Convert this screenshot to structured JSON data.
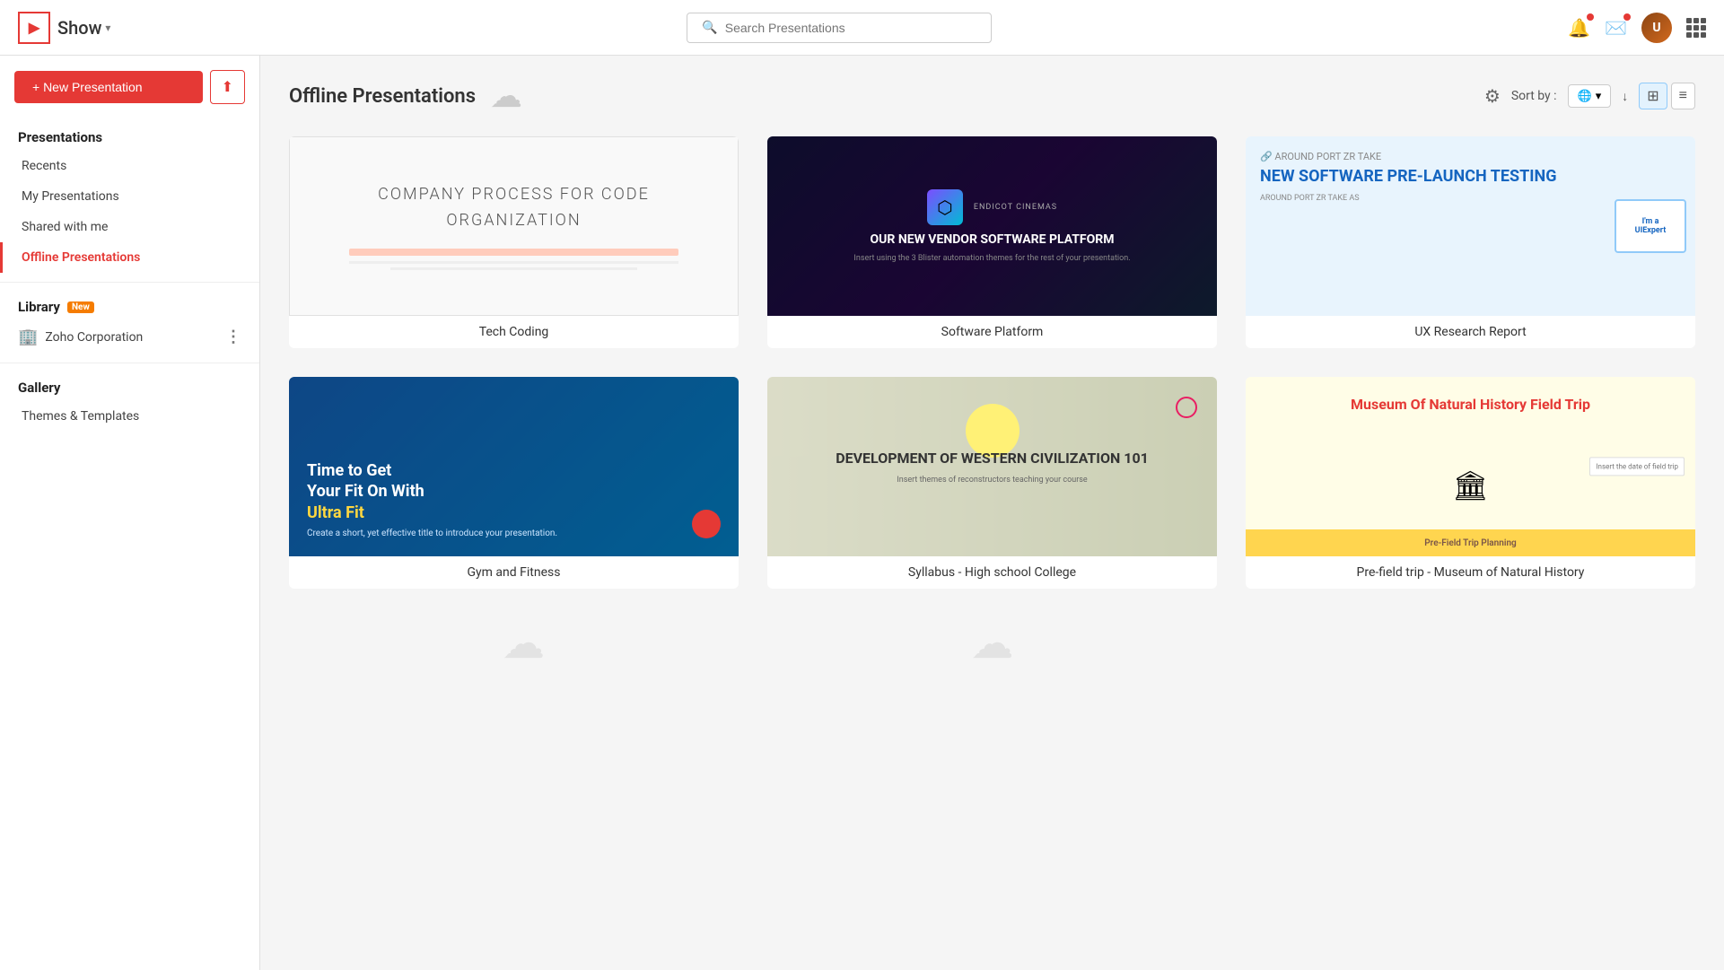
{
  "header": {
    "app_name": "Show",
    "app_arrow": "▾",
    "search_placeholder": "Search Presentations",
    "logo_symbol": "▶"
  },
  "sidebar": {
    "new_presentation_label": "+ New Presentation",
    "upload_label": "⬆",
    "presentations_section": "Presentations",
    "nav_items": [
      {
        "id": "recents",
        "label": "Recents"
      },
      {
        "id": "my-presentations",
        "label": "My Presentations"
      },
      {
        "id": "shared-with-me",
        "label": "Shared with me"
      },
      {
        "id": "offline-presentations",
        "label": "Offline Presentations"
      }
    ],
    "library_section": "Library",
    "library_badge": "New",
    "library_items": [
      {
        "id": "zoho-corp",
        "label": "Zoho Corporation",
        "icon": "🏢"
      }
    ],
    "gallery_section": "Gallery",
    "gallery_items": [
      {
        "id": "themes-templates",
        "label": "Themes & Templates"
      }
    ]
  },
  "main": {
    "title": "Offline Presentations",
    "sort_label": "Sort by :",
    "sort_option": "🌐",
    "presentations": [
      {
        "id": "tech-coding",
        "name": "Tech Coding",
        "thumb_type": "tech",
        "thumb_title": "COMPANY PROCESS FOR CODE ORGANIZATION"
      },
      {
        "id": "software-platform",
        "name": "Software Platform",
        "thumb_type": "software",
        "thumb_company": "ENDICOT CINEMAS",
        "thumb_subtitle": "OUR NEW VENDOR SOFTWARE PLATFORM"
      },
      {
        "id": "ux-research",
        "name": "UX Research Report",
        "thumb_type": "ux",
        "thumb_title": "NEW SOFTWARE PRE-LAUNCH TESTING",
        "thumb_device_label": "I'm a\nUIExpert"
      },
      {
        "id": "gym-fitness",
        "name": "Gym and Fitness",
        "thumb_type": "gym",
        "thumb_line1": "Time to Get",
        "thumb_line2": "Your Fit On With",
        "thumb_highlight": "Ultra Fit",
        "thumb_subtitle": "Create a short, yet effective title to introduce your presentation."
      },
      {
        "id": "syllabus",
        "name": "Syllabus - High school College",
        "thumb_type": "syllabus",
        "thumb_title": "DEVELOPMENT OF WESTERN CIVILIZATION 101",
        "thumb_subtitle": "Insert themes of reconstructors teaching your course"
      },
      {
        "id": "museum",
        "name": "Pre-field trip - Museum of Natural History",
        "thumb_type": "museum",
        "thumb_title": "Museum Of Natural History Field Trip",
        "thumb_bar": "Pre-Field Trip Planning",
        "thumb_note": "Insert the date of field trip"
      }
    ]
  }
}
